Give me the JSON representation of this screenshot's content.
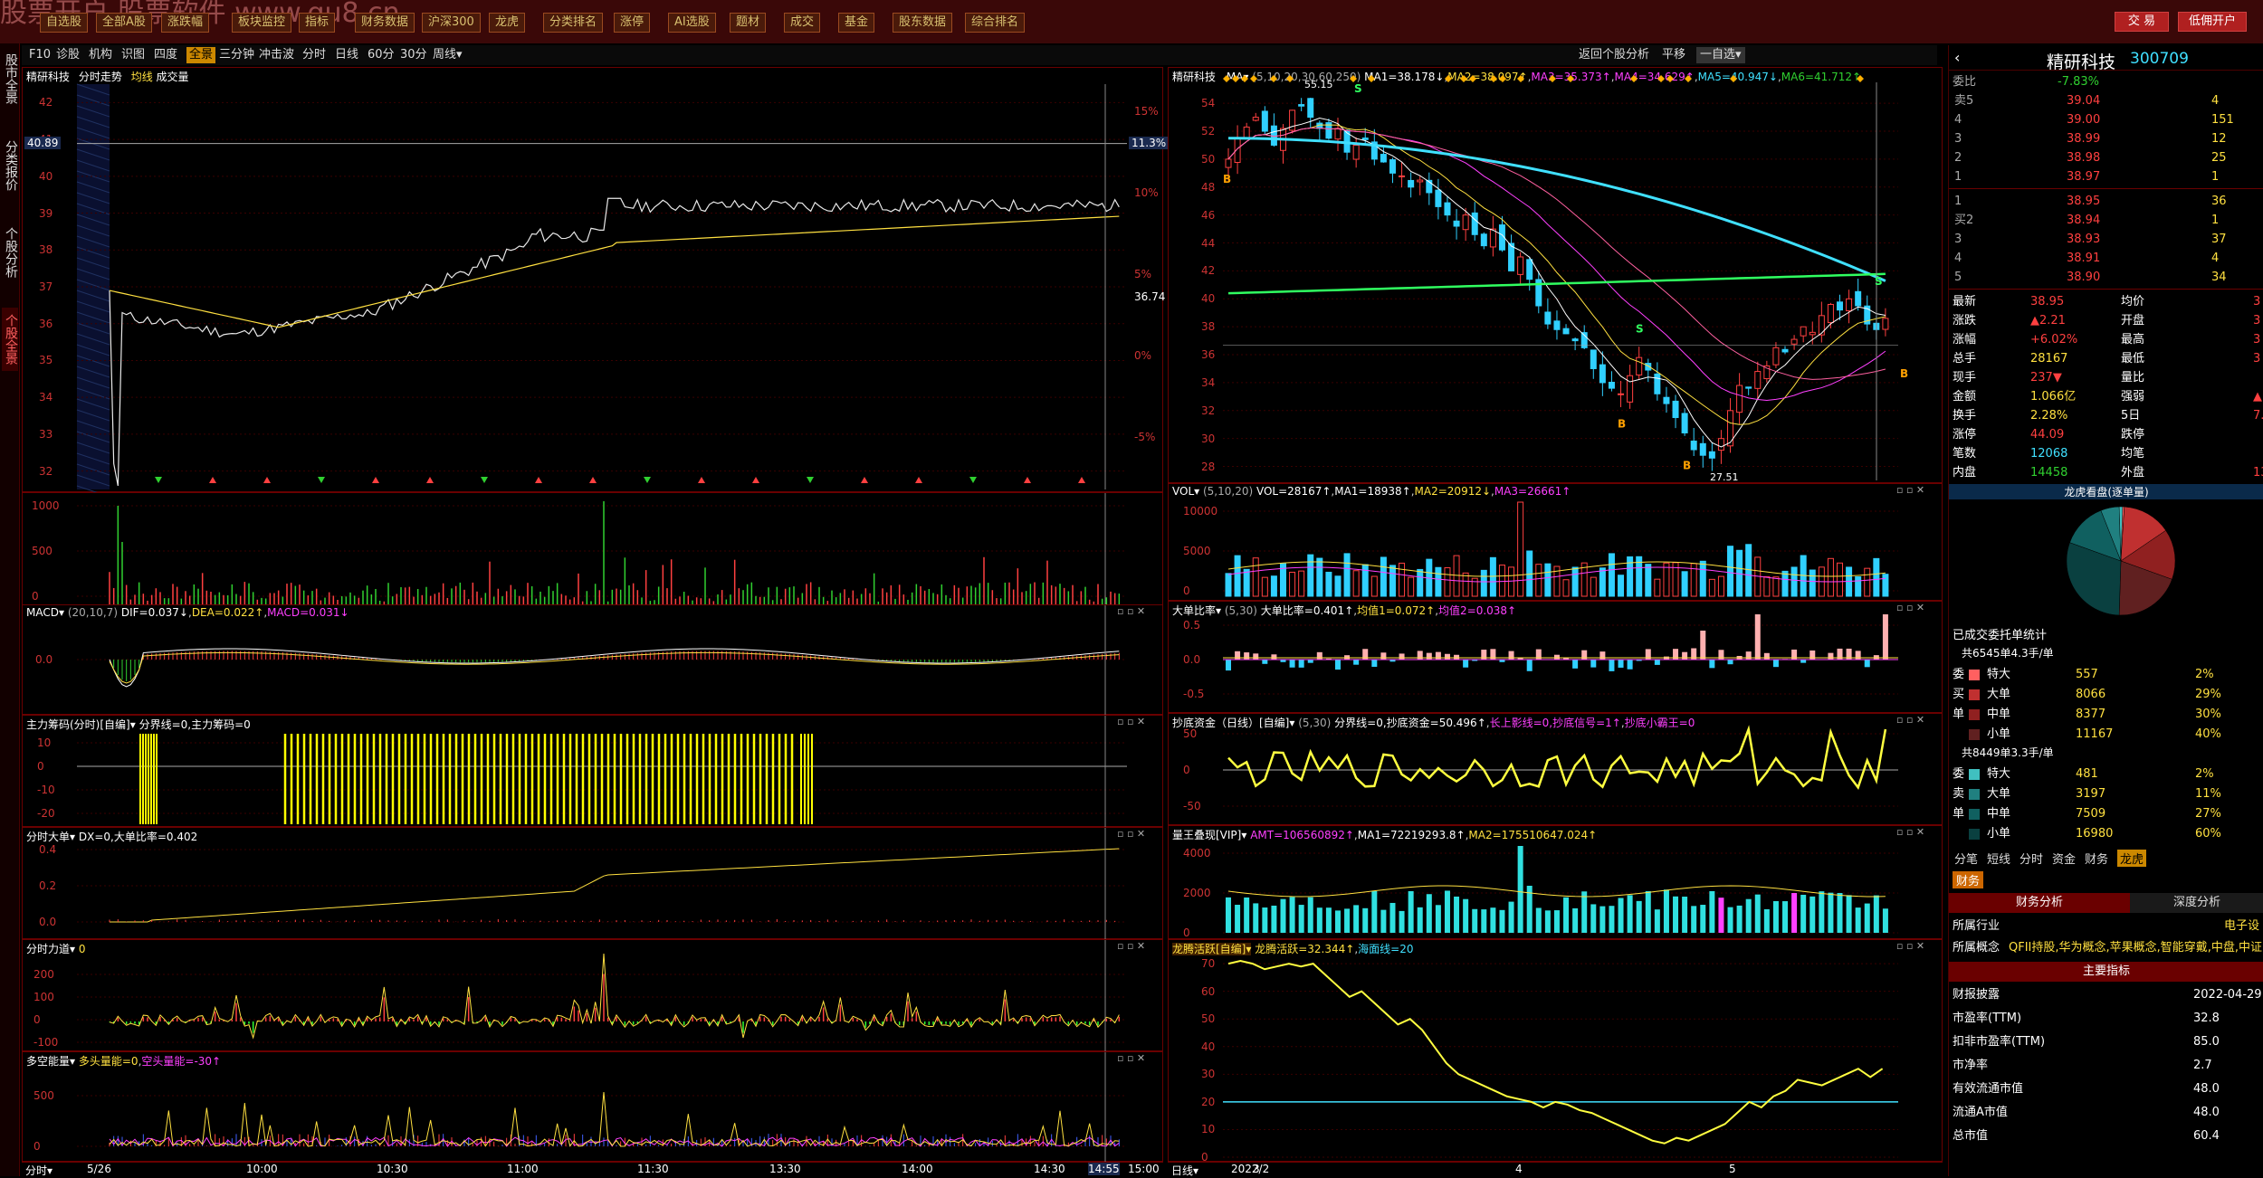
{
  "topbar": {
    "buttons": [
      "自选股",
      "全部A股",
      "涨跌幅",
      "板块监控",
      "指标",
      "财务数据",
      "沪深300",
      "龙虎",
      "分类排名",
      "涨停",
      "AI选股",
      "题材",
      "成交",
      "基金",
      "股东数据",
      "综合排名"
    ],
    "trade": "交 易",
    "account": "低佣开户",
    "watermark": "股票开户  股票软件 www.gu8.cn"
  },
  "sidebar": {
    "tabs": [
      "股市全景",
      "分类报价",
      "个股分析",
      "个股全景"
    ]
  },
  "subtoolbar": {
    "left": [
      "F10",
      "诊股",
      "机构",
      "识图",
      "四度",
      "全景",
      "三分钟",
      "冲击波",
      "分时",
      "日线",
      "60分",
      "30分",
      "周线▾"
    ],
    "right": [
      "返回个股分析",
      "平移",
      "一自选▾"
    ],
    "selected": "全景"
  },
  "intraday": {
    "title_name": "精研科技",
    "title_mode": "分时走势",
    "title_avg": "均线",
    "title_vol": "成交量",
    "price_ticks": [
      "42",
      "41",
      "40",
      "39",
      "38",
      "37",
      "36",
      "35",
      "34",
      "33",
      "32"
    ],
    "pct_ticks": [
      "15%",
      "10%",
      "5%",
      "0%",
      "-5%",
      "-10%"
    ],
    "last_price_label": "40.89",
    "last_pct_label": "11.3%",
    "avg_label": "36.74",
    "time_ticks": [
      "5/26",
      "10:00",
      "10:30",
      "11:00",
      "11:30",
      "13:30",
      "14:00",
      "14:30",
      "14:55",
      "15:00"
    ],
    "corner_label": "分时▾"
  },
  "intraday_vol": {
    "ticks": [
      "1000",
      "500",
      "0"
    ]
  },
  "macd_left": {
    "title": "MACD▾",
    "params": "(20,10,7)",
    "dif": "DIF=0.037↓",
    "dea": "DEA=0.022↑",
    "macd": "MACD=0.031↓",
    "ticks": [
      "0.0"
    ]
  },
  "mainforce": {
    "title": "主力筹码(分时)",
    "extra": "[自编]▾",
    "desc": "分界线=0,主力筹码=0",
    "ticks": [
      "10",
      "0",
      "-10",
      "-20"
    ]
  },
  "bigorder": {
    "title": "分时大单▾",
    "desc": "DX=0,大单比率=0.402",
    "ticks": [
      "0.4",
      "0.2",
      "0.0"
    ]
  },
  "force": {
    "title": "分时力道▾",
    "desc": "0",
    "ticks": [
      "200",
      "100",
      "0",
      "-100"
    ]
  },
  "longshort": {
    "title": "多空能量▾",
    "desc": "多头量能=0",
    "desc2": "空头量能=-30↑",
    "ticks": [
      "500",
      "0"
    ]
  },
  "kline": {
    "name": "精研科技",
    "ma_label": "MA▾",
    "ma_params": "(5,10,20,30,60,250)",
    "ma1": "MA1=38.178↓",
    "ma2": "MA2=38.097↑",
    "ma3": "MA3=35.373↑",
    "ma4": "MA4=34.629↑",
    "ma5": "MA5=40.947↓",
    "ma6": "MA6=41.712↑",
    "high_label": "55.15",
    "low_label": "27.51",
    "ticks": [
      "54",
      "52",
      "50",
      "48",
      "46",
      "44",
      "42",
      "40",
      "38",
      "36",
      "34",
      "32",
      "30",
      "28"
    ],
    "dates": [
      "2022/2",
      "3",
      "4",
      "5"
    ],
    "corner_label": "日线▾"
  },
  "kvol": {
    "title": "VOL▾",
    "params": "(5,10,20)",
    "vol": "VOL=28167↑",
    "ma1": "MA1=18938↑",
    "ma2": "MA2=20912↓",
    "ma3": "MA3=26661↑",
    "ticks": [
      "10000",
      "5000",
      "0"
    ]
  },
  "kbigratio": {
    "title": "大单比率▾",
    "params": "(5,30)",
    "desc": "大单比率=0.401↑",
    "avg1": "均值1=0.072↑",
    "avg2": "均值2=0.038↑",
    "ticks": [
      "0.5",
      "0.0",
      "-0.5"
    ]
  },
  "kbottom": {
    "title": "抄底资金（日线）[自编]▾",
    "params": "(5,30)",
    "desc": "分界线=0,抄底资金=50.496↑",
    "desc2": "长上影线=0,抄底信号=1↑",
    "desc3": "抄底小霸王=0",
    "ticks": [
      "50",
      "0",
      "-50"
    ]
  },
  "kking": {
    "title": "量王叠现[VIP]▾",
    "amt": "AMT=106560892↑",
    "ma1": "MA1=72219293.8↑",
    "ma2": "MA2=175510647.024↑",
    "ticks": [
      "4000",
      "2000",
      "0"
    ]
  },
  "kdragon": {
    "title": "龙腾活跃[自编]▾",
    "desc": "龙腾活跃=32.344↑",
    "desc2": "海面线=20",
    "ticks": [
      "70",
      "60",
      "50",
      "40",
      "30",
      "20",
      "10",
      "0"
    ]
  },
  "quote": {
    "name": "精研科技",
    "code": "300709",
    "weibi_label": "委比",
    "weibi": "-7.83%",
    "sell": [
      {
        "l": "卖5",
        "p": "39.04",
        "v": "4"
      },
      {
        "l": "4",
        "p": "39.00",
        "v": "151"
      },
      {
        "l": "3",
        "p": "38.99",
        "v": "12"
      },
      {
        "l": "2",
        "p": "38.98",
        "v": "25"
      },
      {
        "l": "1",
        "p": "38.97",
        "v": "1"
      }
    ],
    "buy": [
      {
        "l": "1",
        "p": "38.95",
        "v": "36"
      },
      {
        "l": "买2",
        "p": "38.94",
        "v": "1"
      },
      {
        "l": "3",
        "p": "38.93",
        "v": "37"
      },
      {
        "l": "4",
        "p": "38.91",
        "v": "4"
      },
      {
        "l": "5",
        "p": "38.90",
        "v": "34"
      }
    ],
    "stats": [
      {
        "a": "最新",
        "b": "38.95",
        "c": "均价",
        "d": "3"
      },
      {
        "a": "涨跌",
        "b": "▲2.21",
        "c": "开盘",
        "d": "3"
      },
      {
        "a": "涨幅",
        "b": "+6.02%",
        "c": "最高",
        "d": "3"
      },
      {
        "a": "总手",
        "b": "28167",
        "c": "最低",
        "d": "3"
      },
      {
        "a": "现手",
        "b": "237▼",
        "c": "量比",
        "d": ""
      },
      {
        "a": "金额",
        "b": "1.066亿",
        "c": "强弱",
        "d": "▲"
      },
      {
        "a": "换手",
        "b": "2.28%",
        "c": "5日",
        "d": "7."
      },
      {
        "a": "涨停",
        "b": "44.09",
        "c": "跌停",
        "d": ""
      },
      {
        "a": "笔数",
        "b": "12068",
        "c": "均笔",
        "d": ""
      },
      {
        "a": "内盘",
        "b": "14458",
        "c": "外盘",
        "d": "13"
      }
    ],
    "pie_title": "龙虎看盘(逐单量)",
    "entrust_title": "已成交委托单统计",
    "buy_total": "共6545单4.3手/单",
    "buy_rows": [
      {
        "k": "特大",
        "n": "557",
        "p": "2%"
      },
      {
        "k": "大单",
        "n": "8066",
        "p": "29%"
      },
      {
        "k": "中单",
        "n": "8377",
        "p": "30%"
      },
      {
        "k": "小单",
        "n": "11167",
        "p": "40%"
      }
    ],
    "sell_total": "共8449单3.3手/单",
    "sell_rows": [
      {
        "k": "特大",
        "n": "481",
        "p": "2%"
      },
      {
        "k": "大单",
        "n": "3197",
        "p": "11%"
      },
      {
        "k": "中单",
        "n": "7509",
        "p": "27%"
      },
      {
        "k": "小单",
        "n": "16980",
        "p": "60%"
      }
    ],
    "side_buy": [
      "委",
      "买",
      "单"
    ],
    "side_sell": [
      "委",
      "卖",
      "单"
    ],
    "tabs": [
      "分笔",
      "短线",
      "分时",
      "资金",
      "财务",
      "龙虎"
    ],
    "active_tab": "龙虎",
    "fin_tab": "财务",
    "fin_left": "财务分析",
    "fin_right": "深度分析",
    "industry_label": "所属行业",
    "industry": "电子设",
    "concept_label": "所属概念",
    "concept": "QFII持股,华为概念,苹果概念,智能穿戴,中盘,中证",
    "main_idx": "主要指标",
    "fin_rows": [
      {
        "k": "财报披露",
        "v": "2022-04-29"
      },
      {
        "k": "市盈率(TTM)",
        "v": "32.8"
      },
      {
        "k": "扣非市盈率(TTM)",
        "v": "85.0"
      },
      {
        "k": "市净率",
        "v": "2.7"
      },
      {
        "k": "有效流通市值",
        "v": "48.0"
      },
      {
        "k": "流通A市值",
        "v": "48.0"
      },
      {
        "k": "总市值",
        "v": "60.4"
      }
    ]
  },
  "colors": {
    "up": "#ff4040",
    "down": "#30d0ff",
    "ma_white": "#ffffff",
    "ma_yellow": "#ffe040",
    "ma_pink": "#ff40ff",
    "ma_green": "#30ff60",
    "ma_cyan": "#40e0ff",
    "grid": "#6a0000"
  }
}
